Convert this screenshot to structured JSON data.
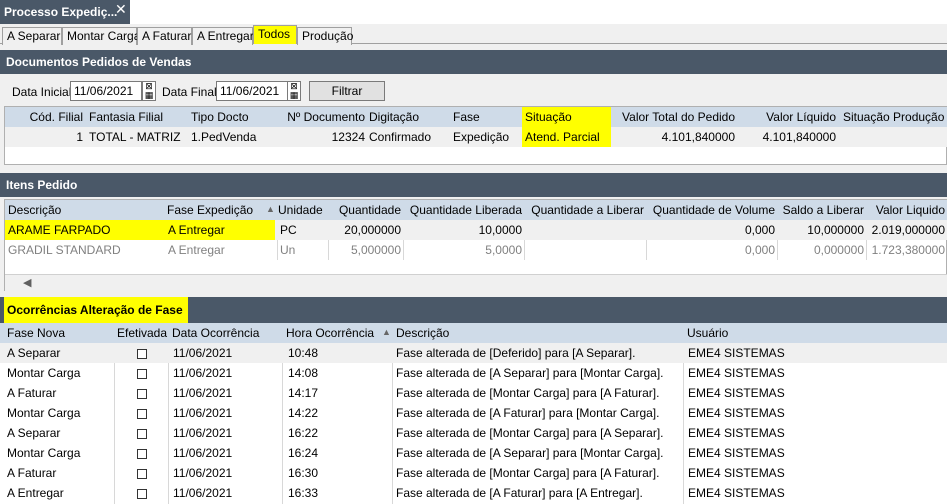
{
  "window": {
    "title": "Processo Expediç...",
    "close_icon": "close-icon"
  },
  "tabs": [
    "A Separar",
    "Montar Carga",
    "A Faturar",
    "A Entregar",
    "Todos",
    "Produção"
  ],
  "active_tab": "Todos",
  "documentos": {
    "title": "Documentos Pedidos de Vendas",
    "filter": {
      "data_inicial_label": "Data Inicial:",
      "data_inicial": "11/06/2021",
      "data_final_label": "Data Final:",
      "data_final": "11/06/2021",
      "filtrar_label": "Filtrar"
    },
    "columns": [
      "Cód. Filial",
      "Fantasia Filial",
      "Tipo Docto",
      "Nº Documento",
      "Digitação",
      "Fase",
      "Situação",
      "Valor Total do Pedido",
      "Valor Líquido",
      "Situação Produção"
    ],
    "rows": [
      [
        "1",
        "TOTAL - MATRIZ",
        "1.PedVenda",
        "12324",
        "Confirmado",
        "Expedição",
        "Atend. Parcial",
        "4.101,840000",
        "4.101,840000",
        ""
      ]
    ]
  },
  "itens": {
    "title": "Itens Pedido",
    "columns": [
      "Descrição",
      "Fase Expedição",
      "Unidade",
      "Quantidade",
      "Quantidade Liberada",
      "Quantidade a Liberar",
      "Quantidade de Volume",
      "Saldo a Liberar",
      "Valor Liquido"
    ],
    "sort_icon": "sort-up-icon",
    "rows": [
      [
        "ARAME FARPADO",
        "A Entregar",
        "PC",
        "20,000000",
        "10,0000",
        "",
        "0,000",
        "10,000000",
        "2.019,000000"
      ],
      [
        "GRADIL STANDARD",
        "A Entregar",
        "Un",
        "5,000000",
        "5,0000",
        "",
        "0,000",
        "0,000000",
        "1.723,380000"
      ]
    ],
    "scroll_left_icon": "scroll-left-icon"
  },
  "ocorrencias": {
    "title": "Ocorrências Alteração de Fase",
    "columns": [
      "Fase Nova",
      "Efetivada",
      "Data Ocorrência",
      "Hora Ocorrência",
      "Descrição",
      "Usuário"
    ],
    "sort_icon": "sort-up-icon",
    "rows": [
      [
        "A Separar",
        "",
        "11/06/2021",
        "10:48",
        "Fase alterada de [Deferido] para [A Separar].",
        "EME4 SISTEMAS"
      ],
      [
        "Montar Carga",
        "",
        "11/06/2021",
        "14:08",
        "Fase alterada de [A Separar] para [Montar Carga].",
        "EME4 SISTEMAS"
      ],
      [
        "A Faturar",
        "",
        "11/06/2021",
        "14:17",
        "Fase alterada de [Montar Carga] para [A Faturar].",
        "EME4 SISTEMAS"
      ],
      [
        "Montar Carga",
        "",
        "11/06/2021",
        "14:22",
        "Fase alterada de [A Faturar] para [Montar Carga].",
        "EME4 SISTEMAS"
      ],
      [
        "A Separar",
        "",
        "11/06/2021",
        "16:22",
        "Fase alterada de [Montar Carga] para [A Separar].",
        "EME4 SISTEMAS"
      ],
      [
        "Montar Carga",
        "",
        "11/06/2021",
        "16:24",
        "Fase alterada de [A Separar] para [Montar Carga].",
        "EME4 SISTEMAS"
      ],
      [
        "A Faturar",
        "",
        "11/06/2021",
        "16:30",
        "Fase alterada de [Montar Carga] para [A Faturar].",
        "EME4 SISTEMAS"
      ],
      [
        "A Entregar",
        "",
        "11/06/2021",
        "16:33",
        "Fase alterada de [A Faturar] para [A Entregar].",
        "EME4 SISTEMAS"
      ]
    ]
  },
  "colors": {
    "header_bg": "#4a5868",
    "grid_header_bg": "#cfdbe8",
    "highlight": "#ffff00",
    "inactive_text": "#808080"
  }
}
